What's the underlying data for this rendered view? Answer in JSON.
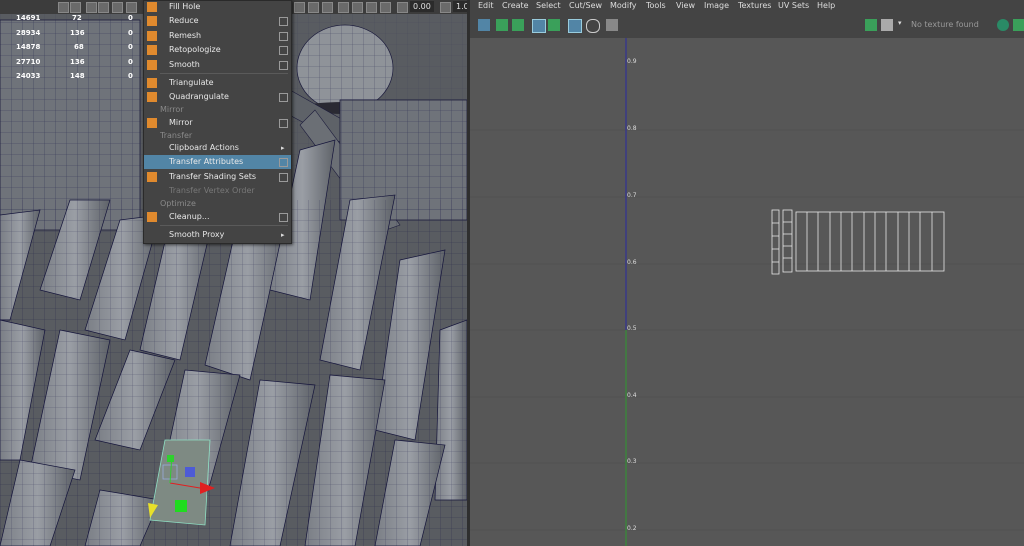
{
  "viewport": {
    "toolbar": {
      "value1": "0.00",
      "value2": "1.0"
    },
    "stats": [
      {
        "a": "14691",
        "b": "72",
        "c": "0"
      },
      {
        "a": "28934",
        "b": "136",
        "c": "0"
      },
      {
        "a": "14878",
        "b": "68",
        "c": "0"
      },
      {
        "a": "27710",
        "b": "136",
        "c": "0"
      },
      {
        "a": "24033",
        "b": "148",
        "c": "0"
      }
    ]
  },
  "menu": {
    "items": [
      {
        "label": "Fill Hole"
      },
      {
        "label": "Reduce"
      },
      {
        "label": "Remesh"
      },
      {
        "label": "Retopologize"
      },
      {
        "label": "Smooth"
      },
      {
        "label": "Triangulate"
      },
      {
        "label": "Quadrangulate"
      },
      {
        "label": "Mirror"
      },
      {
        "label": "Clipboard Actions"
      },
      {
        "label": "Transfer Attributes"
      },
      {
        "label": "Transfer Shading Sets"
      },
      {
        "label": "Transfer Vertex Order"
      },
      {
        "label": "Cleanup..."
      },
      {
        "label": "Smooth Proxy"
      }
    ],
    "sections": {
      "mirror": "Mirror",
      "transfer": "Transfer",
      "optimize": "Optimize"
    }
  },
  "uv_editor": {
    "menubar": [
      "Edit",
      "Create",
      "Select",
      "Cut/Sew",
      "Modify",
      "Tools",
      "View",
      "Image",
      "Textures",
      "UV Sets",
      "Help"
    ],
    "texture_status": "No texture found",
    "ticks": [
      "0.9",
      "0.8",
      "0.7",
      "0.6",
      "0.5",
      "0.4",
      "0.3",
      "0.2"
    ]
  },
  "colors": {
    "highlight": "#5285a6",
    "menu_bg": "#444444",
    "uv_canvas": "#575757",
    "viewport_bg": "#5a5d61"
  }
}
